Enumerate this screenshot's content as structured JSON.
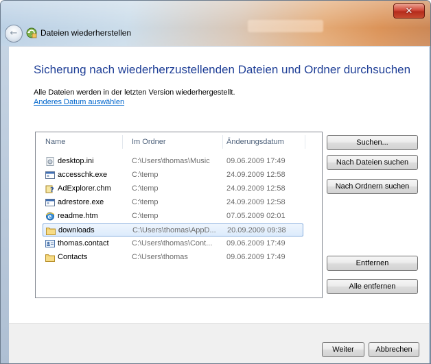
{
  "window": {
    "title": "Dateien wiederherstellen",
    "close_label": "✕"
  },
  "main": {
    "heading": "Sicherung nach wiederherzustellenden Dateien und Ordner durchsuchen",
    "info": "Alle Dateien werden in der letzten Version wiederhergestellt.",
    "date_link": "Anderes Datum auswählen"
  },
  "list": {
    "columns": [
      "Name",
      "Im Ordner",
      "Änderungsdatum"
    ],
    "rows": [
      {
        "name": "desktop.ini",
        "folder": "C:\\Users\\thomas\\Music",
        "date": "09.06.2009 17:49",
        "icon": "settings-file-icon",
        "selected": false
      },
      {
        "name": "accesschk.exe",
        "folder": "C:\\temp",
        "date": "24.09.2009 12:58",
        "icon": "exe-icon",
        "selected": false
      },
      {
        "name": "AdExplorer.chm",
        "folder": "C:\\temp",
        "date": "24.09.2009 12:58",
        "icon": "help-file-icon",
        "selected": false
      },
      {
        "name": "adrestore.exe",
        "folder": "C:\\temp",
        "date": "24.09.2009 12:58",
        "icon": "exe-icon",
        "selected": false
      },
      {
        "name": "readme.htm",
        "folder": "C:\\temp",
        "date": "07.05.2009 02:01",
        "icon": "ie-icon",
        "selected": false
      },
      {
        "name": "downloads",
        "folder": "C:\\Users\\thomas\\AppD...",
        "date": "20.09.2009 09:38",
        "icon": "folder-icon",
        "selected": true
      },
      {
        "name": "thomas.contact",
        "folder": "C:\\Users\\thomas\\Cont...",
        "date": "09.06.2009 17:49",
        "icon": "contact-icon",
        "selected": false
      },
      {
        "name": "Contacts",
        "folder": "C:\\Users\\thomas",
        "date": "09.06.2009 17:49",
        "icon": "folder-icon",
        "selected": false
      }
    ]
  },
  "actions": {
    "search": "Suchen...",
    "search_files": "Nach Dateien suchen",
    "search_folders": "Nach Ordnern suchen",
    "remove": "Entfernen",
    "remove_all": "Alle entfernen"
  },
  "footer": {
    "next": "Weiter",
    "cancel": "Abbrechen"
  },
  "colors": {
    "heading": "#1e3e96",
    "link": "#0066cc",
    "selection_border": "#84acdd",
    "close_button": "#c8412f"
  }
}
